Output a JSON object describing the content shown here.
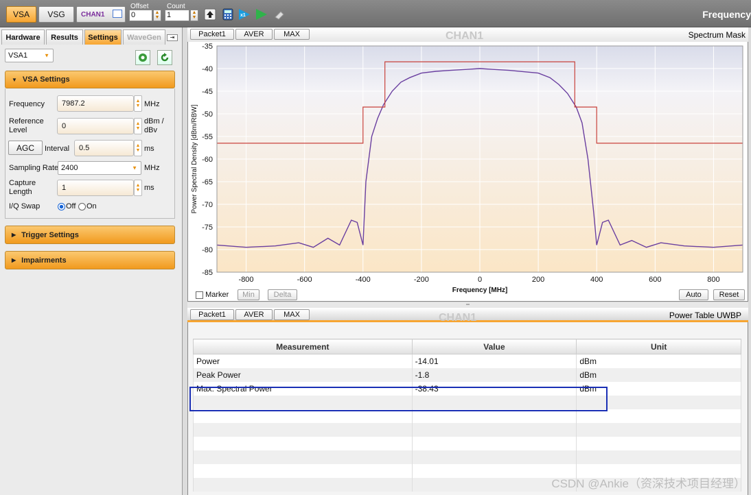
{
  "topbar": {
    "vsa_label": "VSA",
    "vsg_label": "VSG",
    "chan_label": "CHAN1",
    "offset_label": "Offset",
    "offset_value": "0",
    "count_label": "Count",
    "count_value": "1",
    "x1_label": "x1",
    "title": "Frequency"
  },
  "left": {
    "tabs": [
      "Hardware",
      "Results",
      "Settings",
      "WaveGen"
    ],
    "device_select": "VSA1",
    "vsa_settings_title": "VSA Settings",
    "frequency_label": "Frequency",
    "frequency_value": "7987.2",
    "frequency_unit": "MHz",
    "ref_level_label": "Reference Level",
    "ref_level_value": "0",
    "ref_level_unit": "dBm / dBv",
    "agc_label": "AGC",
    "interval_label": "Interval",
    "interval_value": "0.5",
    "interval_unit": "ms",
    "sampling_rate_label": "Sampling Rate",
    "sampling_rate_value": "2400",
    "sampling_rate_unit": "MHz",
    "capture_length_label": "Capture Length",
    "capture_length_value": "1",
    "capture_length_unit": "ms",
    "iq_swap_label": "I/Q Swap",
    "iq_off_label": "Off",
    "iq_on_label": "On",
    "trigger_title": "Trigger Settings",
    "impairments_title": "Impairments"
  },
  "spectrum_panel": {
    "tabs": [
      "Packet1",
      "AVER",
      "MAX"
    ],
    "channel": "CHAN1",
    "title": "Spectrum Mask",
    "marker_label": "Marker",
    "min_label": "Min",
    "delta_label": "Delta",
    "auto_label": "Auto",
    "reset_label": "Reset"
  },
  "power_panel": {
    "tabs": [
      "Packet1",
      "AVER",
      "MAX"
    ],
    "channel": "CHAN1",
    "title": "Power Table UWBP",
    "columns": [
      "Measurement",
      "Value",
      "Unit"
    ],
    "rows": [
      [
        "Power",
        "-14.01",
        "dBm"
      ],
      [
        "Peak Power",
        "-1.8",
        "dBm"
      ],
      [
        "Max. Spectral Power",
        "-38.43",
        "dBm"
      ]
    ]
  },
  "watermark": "CSDN @Ankie（资深技术项目经理）",
  "chart_data": {
    "type": "line",
    "title": "",
    "xlabel": "Frequency [MHz]",
    "ylabel": "Power Spectral Density [dBm/RBW]",
    "xlim": [
      -900,
      900
    ],
    "ylim": [
      -85,
      -35
    ],
    "xticks": [
      -800,
      -600,
      -400,
      -200,
      0,
      200,
      400,
      600,
      800
    ],
    "yticks": [
      -35,
      -40,
      -45,
      -50,
      -55,
      -60,
      -65,
      -70,
      -75,
      -80,
      -85
    ],
    "series": [
      {
        "color": "#6a3fa0",
        "x": [
          -900,
          -800,
          -700,
          -620,
          -570,
          -520,
          -480,
          -440,
          -420,
          -400,
          -390,
          -370,
          -350,
          -330,
          -300,
          -270,
          -240,
          -200,
          -150,
          -100,
          -50,
          0,
          50,
          100,
          150,
          200,
          240,
          270,
          300,
          330,
          350,
          370,
          390,
          400,
          420,
          440,
          480,
          520,
          570,
          620,
          700,
          800,
          900
        ],
        "y": [
          -79,
          -79.5,
          -79.2,
          -78.5,
          -79.5,
          -77.5,
          -79,
          -73.5,
          -74,
          -79,
          -65,
          -55,
          -51,
          -48,
          -45,
          -43,
          -42,
          -41,
          -40.6,
          -40.4,
          -40.2,
          -40,
          -40.2,
          -40.4,
          -40.7,
          -41,
          -42,
          -43.5,
          -45.5,
          -48.5,
          -52,
          -60,
          -72,
          -79,
          -74,
          -73.5,
          -79,
          -78,
          -79.5,
          -78.5,
          -79.2,
          -79.5,
          -79
        ]
      },
      {
        "color": "#c8413b",
        "x": [
          -900,
          -400,
          -400,
          -325,
          -325,
          325,
          325,
          400,
          400,
          900
        ],
        "y": [
          -56.5,
          -56.5,
          -48.5,
          -48.5,
          -38.5,
          -38.5,
          -48.5,
          -48.5,
          -56.5,
          -56.5
        ]
      }
    ]
  }
}
